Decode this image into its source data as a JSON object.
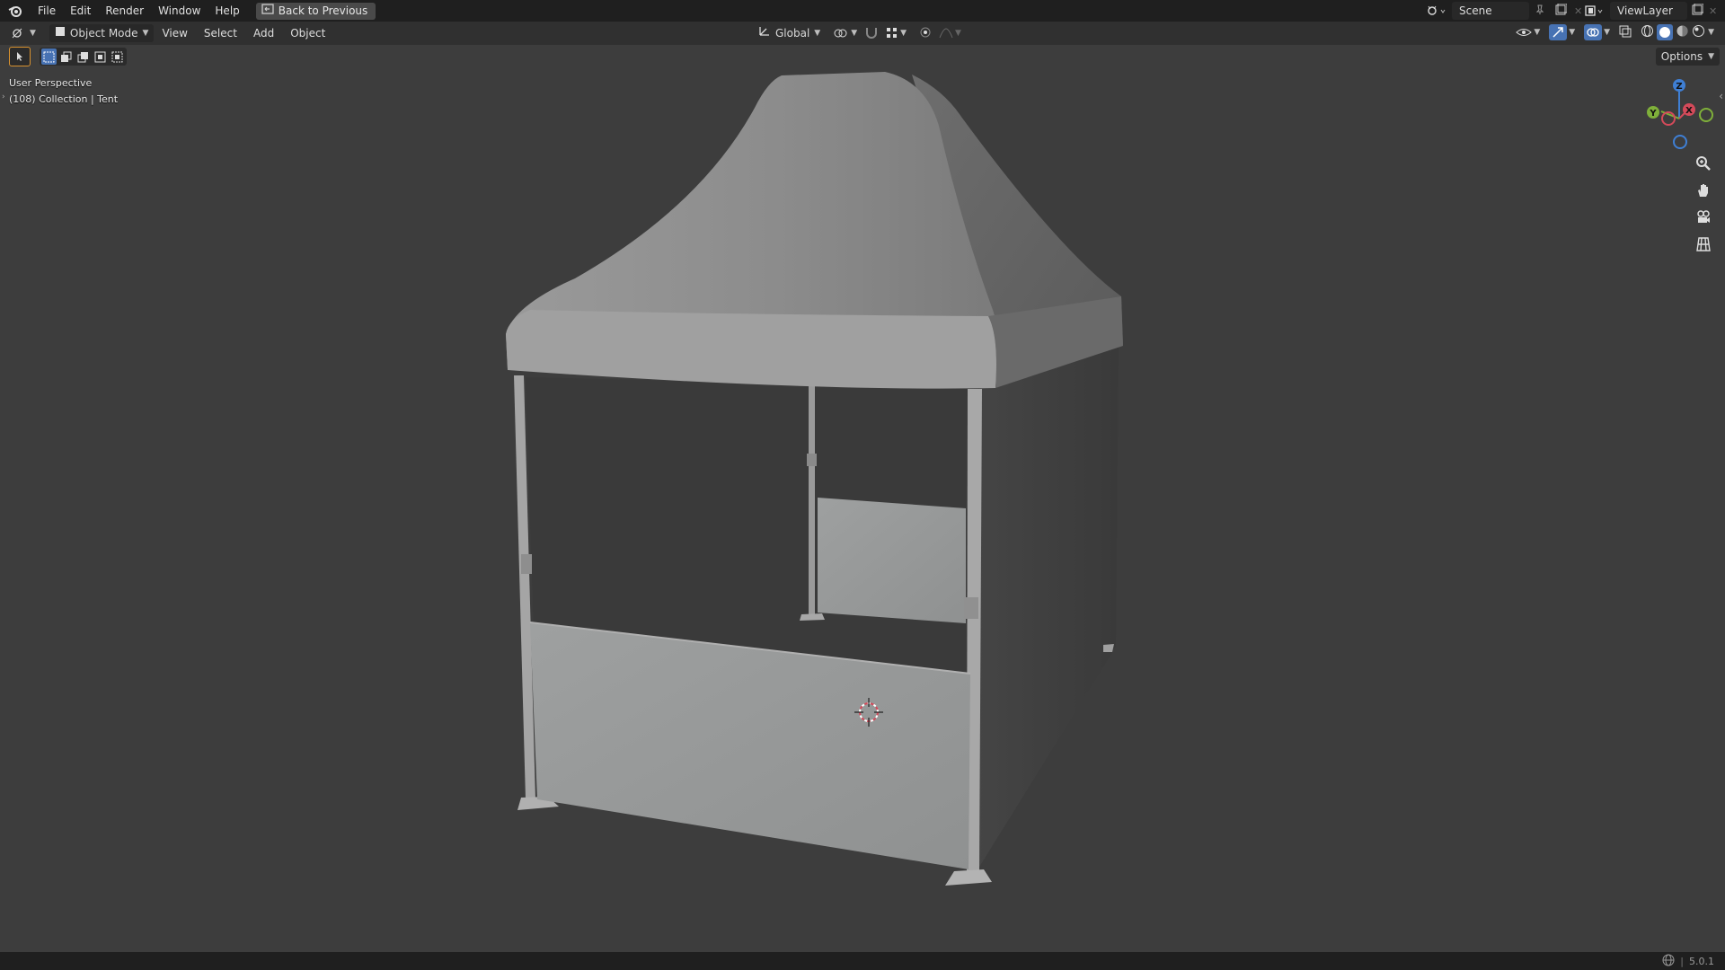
{
  "topbar": {
    "menus": [
      "File",
      "Edit",
      "Render",
      "Window",
      "Help"
    ],
    "back_button": "Back to Previous",
    "scene": "Scene",
    "view_layer": "ViewLayer"
  },
  "header": {
    "editor_icon": "viewport-icon",
    "mode": "Object Mode",
    "menus": [
      "View",
      "Select",
      "Add",
      "Object"
    ],
    "orientation": "Global",
    "options_label": "Options"
  },
  "viewport": {
    "perspective_label": "User Perspective",
    "collection_label": "(108) Collection | Tent",
    "gizmo": {
      "z": "Z",
      "y": "Y",
      "x": "X"
    }
  },
  "statusbar": {
    "version": "5.0.1"
  },
  "colors": {
    "accent": "#4772b3",
    "topbar": "#1f1f1f",
    "viewport_bg": "#3d3d3d",
    "axis_x": "#d44a5a",
    "axis_y": "#7fb03a",
    "axis_z": "#3f7fd4"
  }
}
